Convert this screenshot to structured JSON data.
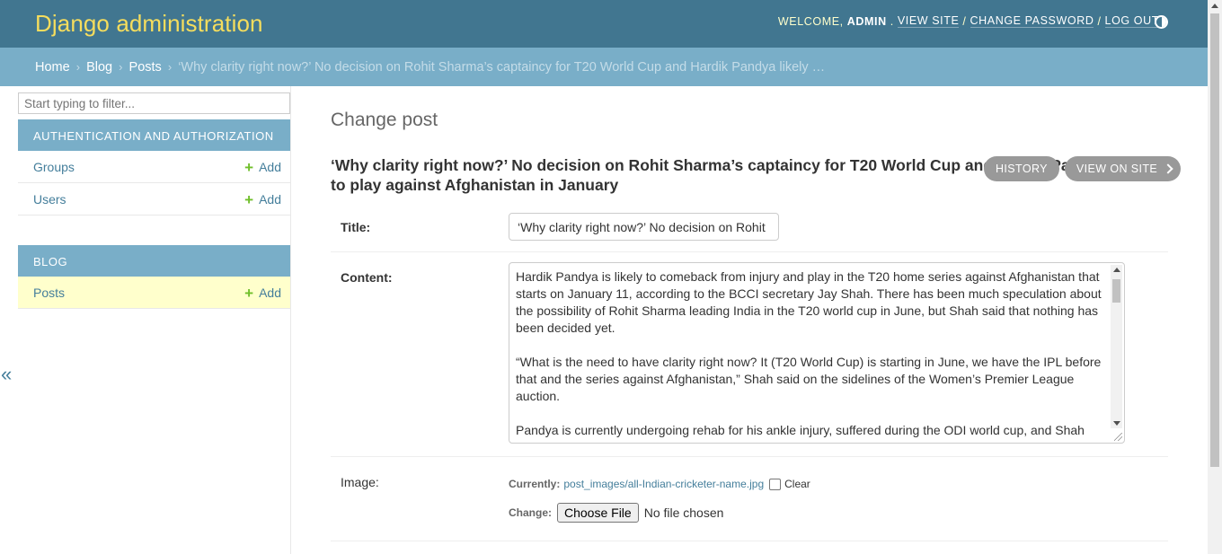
{
  "header": {
    "brand": "Django administration",
    "welcome": "WELCOME,",
    "username": "ADMIN",
    "view_site": "VIEW SITE",
    "change_password": "CHANGE PASSWORD",
    "log_out": "LOG OUT",
    "sep": "/"
  },
  "breadcrumbs": {
    "home": "Home",
    "blog": "Blog",
    "posts": "Posts",
    "current": "‘Why clarity right now?’ No decision on Rohit Sharma’s captaincy for T20 World Cup and Hardik Pandya likely …",
    "sep": "›"
  },
  "sidebar": {
    "filter_placeholder": "Start typing to filter...",
    "modules": [
      {
        "caption": "AUTHENTICATION AND AUTHORIZATION",
        "models": [
          {
            "name": "Groups",
            "add": "Add"
          },
          {
            "name": "Users",
            "add": "Add"
          }
        ]
      },
      {
        "caption": "BLOG",
        "models": [
          {
            "name": "Posts",
            "add": "Add"
          }
        ]
      }
    ],
    "collapse": "«"
  },
  "content": {
    "page_title": "Change post",
    "object_title": "‘Why clarity right now?’ No decision on Rohit Sharma’s captaincy for T20 World Cup and Hardik Pandya likely to play against Afghanistan in January",
    "history": "HISTORY",
    "view_on_site": "VIEW ON SITE",
    "fields": {
      "title_label": "Title:",
      "title_value": "‘Why clarity right now?’ No decision on Rohit",
      "content_label": "Content:",
      "content_paragraphs": [
        "Hardik Pandya is likely to comeback from injury and play in the T20 home series against Afghanistan that starts on January 11, according to the BCCI secretary Jay Shah. There has been much speculation about the possibility of Rohit Sharma leading India in the T20 world cup in June, but Shah said that nothing has been decided yet.",
        "“What is the need to have clarity right now? It (T20 World Cup) is starting in June, we have the IPL before that and the series against Afghanistan,” Shah said on the sidelines of the Women’s Premier League auction.",
        "Pandya is currently undergoing rehab for his ankle injury, suffered during the ODI world cup, and Shah"
      ],
      "image_label": "Image:",
      "currently_label": "Currently:",
      "currently_file": "post_images/all-Indian-cricketer-name.jpg",
      "clear_label": "Clear",
      "change_label": "Change:",
      "choose_file": "Choose File",
      "no_file": "No file chosen"
    }
  }
}
